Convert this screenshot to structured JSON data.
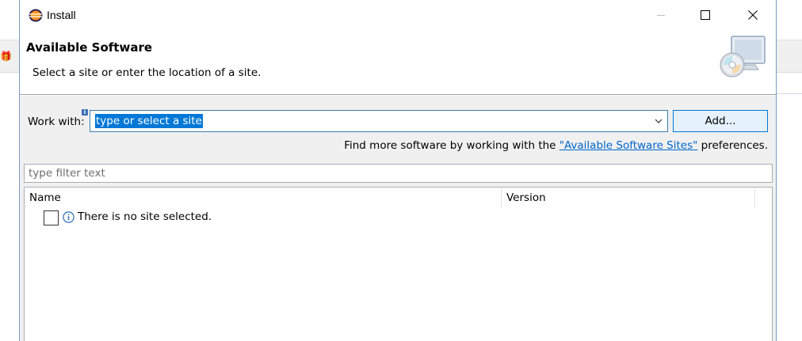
{
  "window": {
    "title": "Install"
  },
  "banner": {
    "title": "Available Software",
    "description": "Select a site or enter the location of a site."
  },
  "work_with": {
    "label": "Work with:",
    "value": "type or select a site",
    "add_button": "Add...",
    "find_more_prefix": "Find more software by working with the ",
    "find_more_link": "\"Available Software Sites\"",
    "find_more_suffix": " preferences."
  },
  "filter": {
    "placeholder": "type filter text"
  },
  "tree": {
    "columns": [
      "Name",
      "Version"
    ],
    "rows": [
      {
        "checked": false,
        "icon": "info-icon",
        "text": "There is no site selected."
      }
    ]
  },
  "icons": {
    "app": "eclipse-icon",
    "banner": "install-software-icon",
    "minimize": "minimize-icon",
    "maximize": "maximize-icon",
    "close": "close-icon",
    "dropdown": "chevron-down-icon",
    "field_info": "info-decoration-icon"
  },
  "colors": {
    "selection": "#0078d7",
    "link": "#0066cc",
    "button_bg": "#e5f1fb",
    "dialog_border": "#7a9cc6"
  }
}
